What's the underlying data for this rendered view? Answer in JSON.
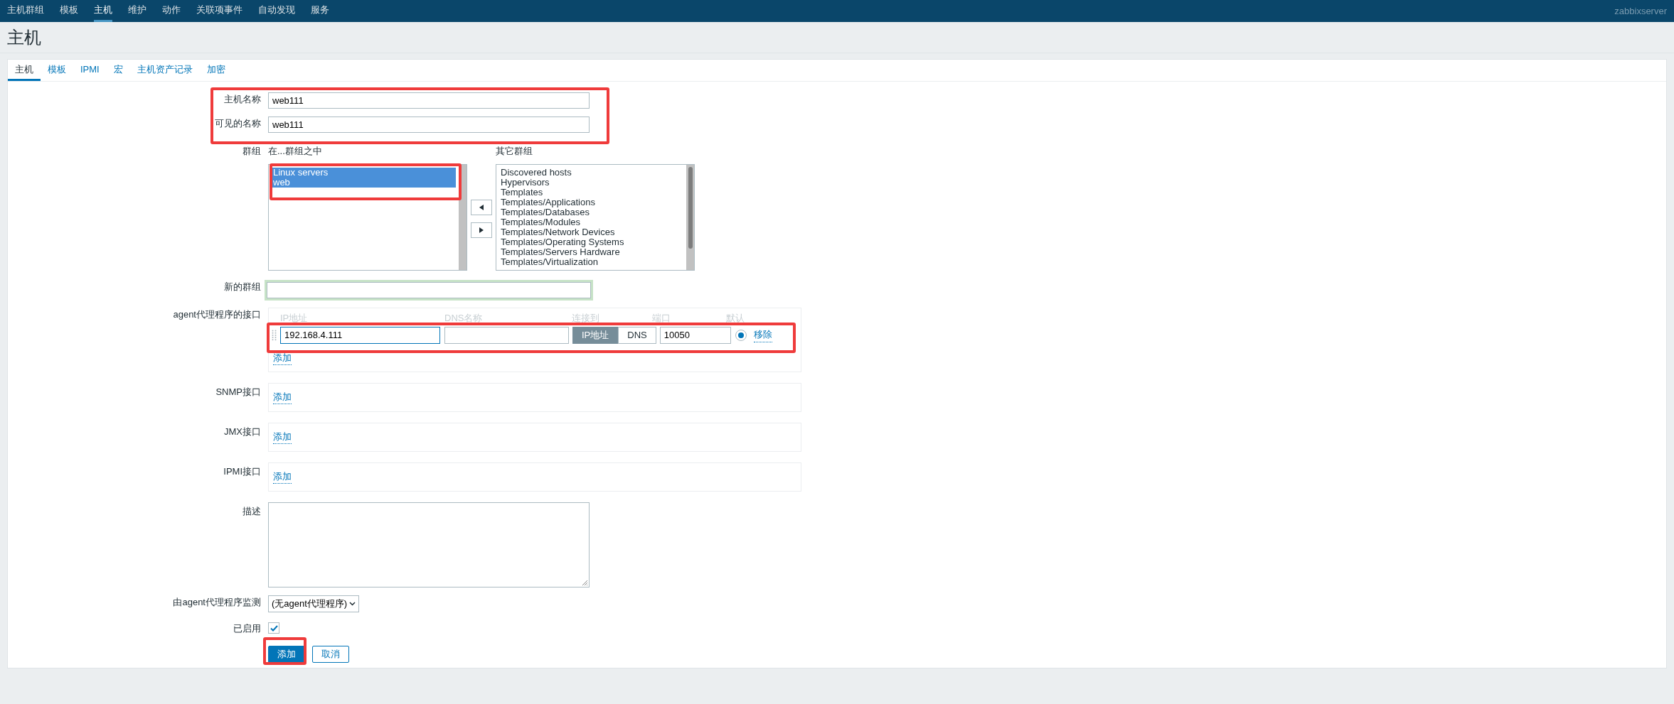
{
  "top_nav": {
    "items": [
      {
        "label": "主机群组",
        "selected": false
      },
      {
        "label": "模板",
        "selected": false
      },
      {
        "label": "主机",
        "selected": true
      },
      {
        "label": "维护",
        "selected": false
      },
      {
        "label": "动作",
        "selected": false
      },
      {
        "label": "关联项事件",
        "selected": false
      },
      {
        "label": "自动发现",
        "selected": false
      },
      {
        "label": "服务",
        "selected": false
      }
    ],
    "server_name": "zabbixserver"
  },
  "page_title": "主机",
  "tabs": [
    {
      "label": "主机",
      "selected": true
    },
    {
      "label": "模板",
      "selected": false
    },
    {
      "label": "IPMI",
      "selected": false
    },
    {
      "label": "宏",
      "selected": false
    },
    {
      "label": "主机资产记录",
      "selected": false
    },
    {
      "label": "加密",
      "selected": false
    }
  ],
  "form": {
    "host_name": {
      "label": "主机名称",
      "value": "web111"
    },
    "visible_name": {
      "label": "可见的名称",
      "value": "web111"
    },
    "groups": {
      "label": "群组",
      "in_groups_title": "在...群组之中",
      "other_groups_title": "其它群组",
      "in_groups": [
        {
          "label": "Linux servers",
          "selected": true
        },
        {
          "label": "web",
          "selected": true
        }
      ],
      "other_groups": [
        {
          "label": "Discovered hosts",
          "selected": false
        },
        {
          "label": "Hypervisors",
          "selected": false
        },
        {
          "label": "Templates",
          "selected": false
        },
        {
          "label": "Templates/Applications",
          "selected": false
        },
        {
          "label": "Templates/Databases",
          "selected": false
        },
        {
          "label": "Templates/Modules",
          "selected": false
        },
        {
          "label": "Templates/Network Devices",
          "selected": false
        },
        {
          "label": "Templates/Operating Systems",
          "selected": false
        },
        {
          "label": "Templates/Servers Hardware",
          "selected": false
        },
        {
          "label": "Templates/Virtualization",
          "selected": false
        }
      ]
    },
    "new_group": {
      "label": "新的群组"
    },
    "agent_interfaces": {
      "label": "agent代理程序的接口",
      "columns": [
        "IP地址",
        "DNS名称",
        "连接到",
        "端口",
        "默认"
      ],
      "rows": [
        {
          "ip": "192.168.4.111",
          "connect_options": [
            {
              "label": "IP地址",
              "selected": true
            },
            {
              "label": "DNS",
              "selected": false
            }
          ],
          "port": "10050",
          "default": true,
          "remove_label": "移除"
        }
      ],
      "add_label": "添加"
    },
    "other_interfaces": [
      {
        "label": "SNMP接口",
        "add_label": "添加"
      },
      {
        "label": "JMX接口",
        "add_label": "添加"
      },
      {
        "label": "IPMI接口",
        "add_label": "添加"
      }
    ],
    "description": {
      "label": "描述"
    },
    "proxy": {
      "label": "由agent代理程序监测",
      "value": "(无agent代理程序)"
    },
    "enabled": {
      "label": "已启用",
      "checked": true
    },
    "buttons": [
      {
        "label": "添加",
        "kind": "primary"
      },
      {
        "label": "取消",
        "kind": "secondary"
      }
    ]
  }
}
